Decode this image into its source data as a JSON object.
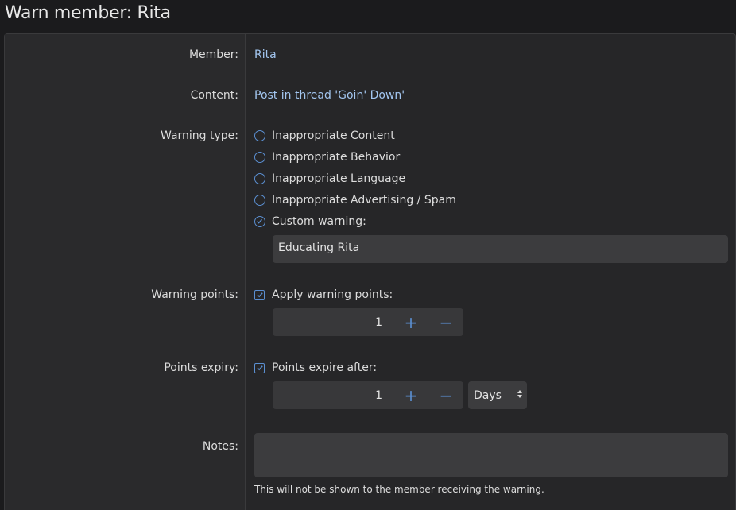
{
  "page": {
    "title": "Warn member: Rita"
  },
  "form": {
    "member": {
      "label": "Member:",
      "value": "Rita"
    },
    "content": {
      "label": "Content:",
      "value": "Post in thread 'Goin' Down'"
    },
    "warning_type": {
      "label": "Warning type:",
      "options": [
        {
          "label": "Inappropriate Content",
          "checked": false
        },
        {
          "label": "Inappropriate Behavior",
          "checked": false
        },
        {
          "label": "Inappropriate Language",
          "checked": false
        },
        {
          "label": "Inappropriate Advertising / Spam",
          "checked": false
        },
        {
          "label": "Custom warning:",
          "checked": true
        }
      ],
      "custom_value": "Educating Rita"
    },
    "warning_points": {
      "label": "Warning points:",
      "checkbox_label": "Apply warning points:",
      "checked": true,
      "value": "1",
      "plus": "+",
      "minus": "−"
    },
    "points_expiry": {
      "label": "Points expiry:",
      "checkbox_label": "Points expire after:",
      "checked": true,
      "value": "1",
      "plus": "+",
      "minus": "−",
      "unit": "Days"
    },
    "notes": {
      "label": "Notes:",
      "value": "",
      "hint": "This will not be shown to the member receiving the warning."
    }
  },
  "colors": {
    "accent": "#5b8fd1",
    "link": "#a3c6f0",
    "background": "#1b1b1d",
    "panel": "#262628"
  }
}
